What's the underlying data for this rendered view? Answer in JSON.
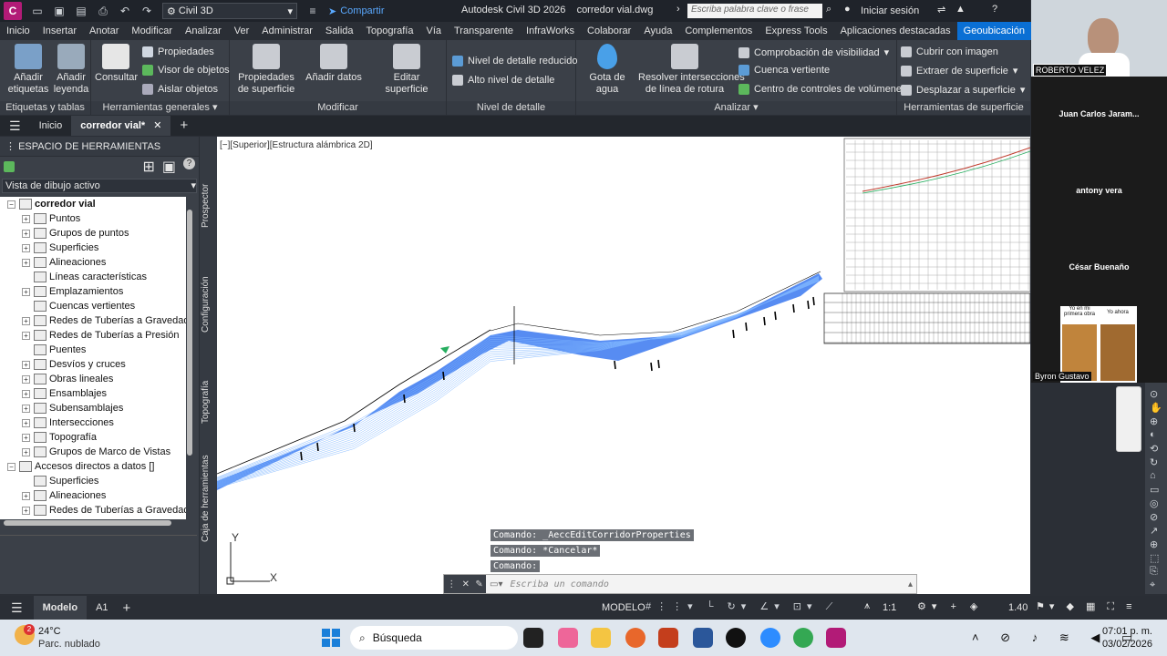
{
  "titlebar": {
    "app_badge": "C",
    "workspace": "Civil 3D",
    "share_label": "Compartir",
    "title": "Autodesk Civil 3D 2026    corredor vial.dwg",
    "search_placeholder": "Escriba palabra clave o frase",
    "signin": "Iniciar sesión"
  },
  "menu": [
    "Inicio",
    "Insertar",
    "Anotar",
    "Modificar",
    "Analizar",
    "Ver",
    "Administrar",
    "Salida",
    "Topografía",
    "Vía",
    "Transparente",
    "InfraWorks",
    "Colaborar",
    "Ayuda",
    "Complementos",
    "Express Tools",
    "Aplicaciones destacadas",
    "Geoubicación"
  ],
  "ribbon": {
    "p1": {
      "title": "Etiquetas y tablas",
      "btn1": "Añadir\netiquetas",
      "btn2": "Añadir\nleyenda"
    },
    "p2": {
      "title": "Herramientas generales",
      "btn1": "Consultar",
      "s1": "Propiedades",
      "s2": "Visor de objetos",
      "s3": "Aislar objetos"
    },
    "p3": {
      "title": "Modificar",
      "btn1": "Propiedades\nde superficie",
      "btn2": "Añadir datos",
      "btn3": "Editar superficie"
    },
    "p4": {
      "title": "Nivel de detalle",
      "s1": "Nivel de detalle reducido",
      "s2": "Alto nivel de detalle"
    },
    "p5": {
      "title": "Analizar",
      "btn1": "Gota de agua",
      "btn2": "Resolver intersecciones\nde línea de rotura",
      "s1": "Comprobación de visibilidad",
      "s2": "Cuenca vertiente",
      "s3": "Centro de controles de volúmenes"
    },
    "p6": {
      "title": "Herramientas de superficie",
      "s1": "Cubrir con imagen",
      "s2": "Extraer de superficie",
      "s3": "Desplazar a superficie"
    }
  },
  "tabs": {
    "home": "Inicio",
    "doc": "corredor vial*"
  },
  "toolspace": {
    "header": "ESPACIO DE HERRAMIENTAS",
    "view": "Vista de dibujo activo",
    "root": "corredor vial",
    "items": [
      "Puntos",
      "Grupos de puntos",
      "Superficies",
      "Alineaciones",
      "Líneas características",
      "Emplazamientos",
      "Cuencas vertientes",
      "Redes de Tuberías a Gravedad",
      "Redes de Tuberías a Presión",
      "Puentes",
      "Desvíos y cruces",
      "Obras lineales",
      "Ensamblajes",
      "Subensamblajes",
      "Intersecciones",
      "Topografía",
      "Grupos de Marco de Vistas"
    ],
    "shortcuts": "Accesos directos a datos []",
    "sc_items": [
      "Superficies",
      "Alineaciones",
      "Redes de Tuberías a Gravedad"
    ]
  },
  "sidetabs": [
    "Prospector",
    "Configuración",
    "Topografía",
    "Caja de herramientas"
  ],
  "viewport": {
    "label": "[−][Superior][Estructura alámbrica 2D]",
    "cmd1": "Comando: _AeccEditCorridorProperties",
    "cmd2": "Comando: *Cancelar*",
    "cmd3": "Comando:",
    "cmd_placeholder": "Escriba un comando",
    "ucs_y": "Y",
    "ucs_x": "X"
  },
  "status": {
    "model": "Modelo",
    "layout": "A1",
    "mode": "MODELO",
    "scale": "1:1",
    "zoom": "1.40"
  },
  "video": {
    "p1": "ROBERTO VELEZ",
    "p2": "Juan Carlos Jaram...",
    "p3": "antony vera",
    "p4": "César Buenaño",
    "p5": "Byron Gustavo",
    "meme1": "Yo en mi primera obra",
    "meme2": "Yo ahora"
  },
  "taskbar": {
    "weather_temp": "24°C",
    "weather_desc": "Parc. nublado",
    "badge": "2",
    "search": "Búsqueda",
    "time": "07:01 p. m.",
    "date": "03/02/2026"
  },
  "colors": {
    "accent": "#0a6fd4",
    "corridor": "#2f6fe8",
    "app": "#b21b77"
  }
}
